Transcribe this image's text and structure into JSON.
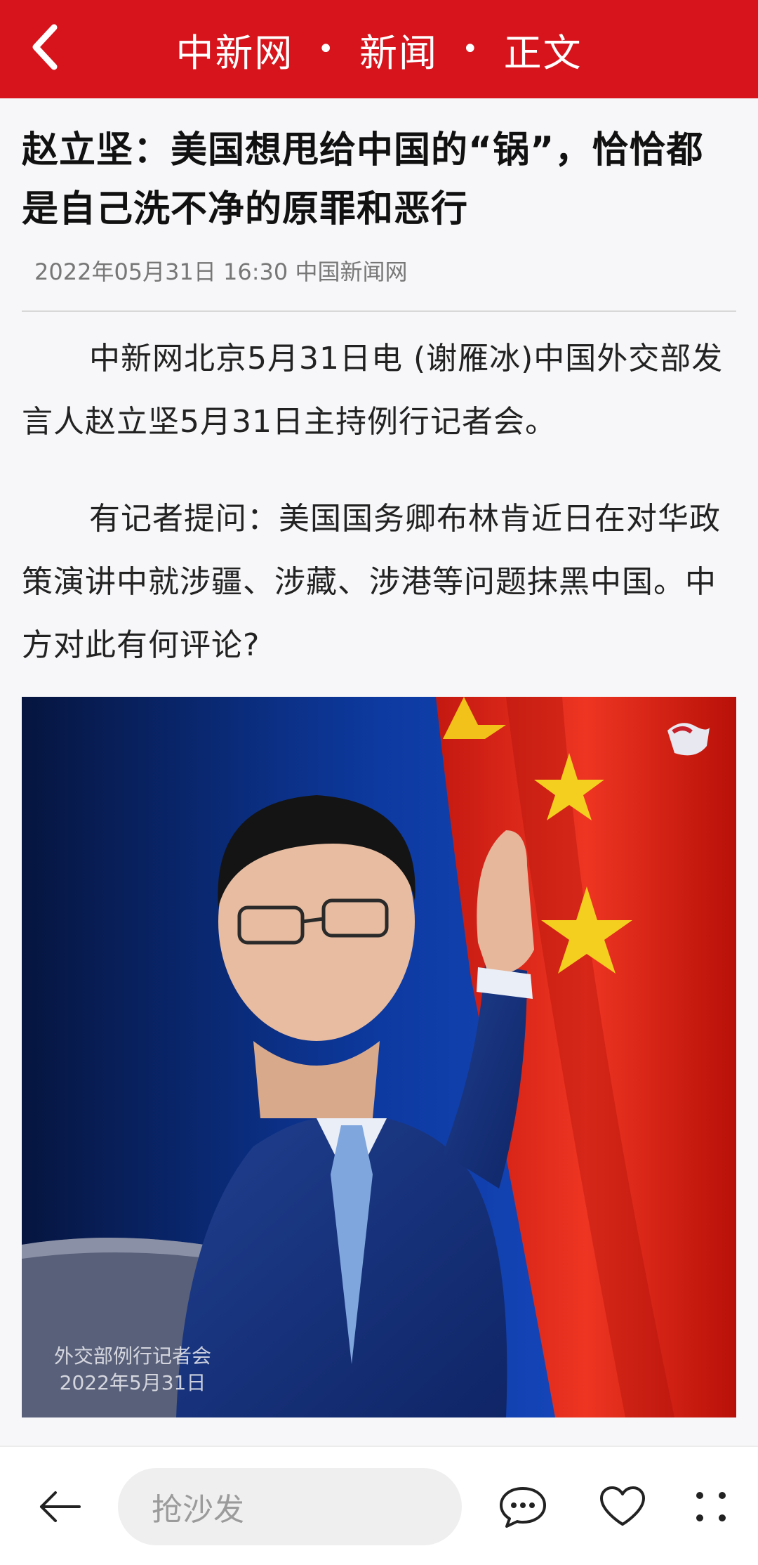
{
  "header": {
    "site": "中新网",
    "section": "新闻",
    "page": "正文",
    "bg_color": "#d7141c"
  },
  "article": {
    "title": "赵立坚：美国想甩给中国的“锅”，恰恰都是自己洗不净的原罪和恶行",
    "meta": "2022年05月31日 16:30 中国新闻网",
    "paragraphs": [
      "中新网北京5月31日电 (谢雁冰)中国外交部发言人赵立坚5月31日主持例行记者会。",
      "有记者提问：美国国务卿布林肯近日在对华政策演讲中就涉疆、涉藏、涉港等问题抹黑中国。中方对此有何评论?"
    ],
    "photo": {
      "caption_line1": "外交部例行记者会",
      "caption_line2": "2022年5月31日"
    }
  },
  "toolbar": {
    "comment_placeholder": "抢沙发",
    "icons": [
      "back-arrow-icon",
      "comment-icon",
      "heart-icon",
      "more-dots-icon"
    ]
  }
}
